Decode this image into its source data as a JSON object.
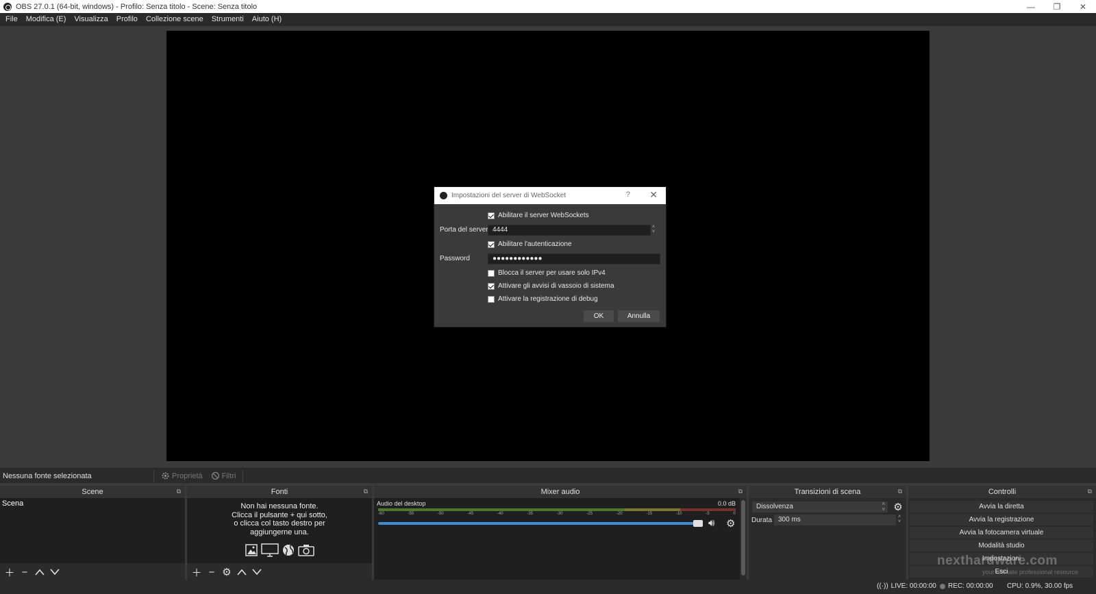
{
  "window": {
    "title": "OBS 27.0.1 (64-bit, windows) - Profilo: Senza titolo - Scene: Senza titolo",
    "minimize": "—",
    "restore": "❐",
    "close": "✕"
  },
  "menu": [
    "File",
    "Modifica (E)",
    "Visualizza",
    "Profilo",
    "Collezione scene",
    "Strumenti",
    "Aiuto (H)"
  ],
  "source_bar": {
    "selected": "Nessuna fonte selezionata",
    "properties": "Proprietà",
    "filters": "Filtri"
  },
  "docks": {
    "scenes": {
      "title": "Scene",
      "items": [
        "Scena"
      ]
    },
    "sources": {
      "title": "Fonti",
      "empty_lines": [
        "Non hai nessuna fonte.",
        "Clicca il pulsante + qui sotto,",
        "o clicca col tasto destro per",
        "aggiungerne una."
      ]
    },
    "mixer": {
      "title": "Mixer audio",
      "track": {
        "name": "Audio del desktop",
        "db": "0.0 dB"
      },
      "ticks": [
        "-60",
        "-55",
        "-50",
        "-45",
        "-40",
        "-35",
        "-30",
        "-25",
        "-20",
        "-15",
        "-10",
        "-5",
        "0"
      ],
      "volume_fraction": 1.0
    },
    "transitions": {
      "title": "Transizioni di scena",
      "selected": "Dissolvenza",
      "duration_label": "Durata",
      "duration": "300 ms"
    },
    "controls": {
      "title": "Controlli",
      "buttons": [
        "Avvia la diretta",
        "Avvia la registrazione",
        "Avvia la fotocamera virtuale",
        "Modalità studio",
        "Impostazioni",
        "Esci"
      ]
    }
  },
  "status": {
    "live": "LIVE: 00:00:00",
    "rec": "REC: 00:00:00",
    "cpu": "CPU: 0.9%, 30.00 fps"
  },
  "watermark": {
    "brand": "nexthardware.com",
    "tagline": "your ultimate professional resource"
  },
  "dialog": {
    "title": "Impostazioni del server di WebSocket",
    "help": "?",
    "close": "✕",
    "enable_server": {
      "label": "Abilitare il server WebSockets",
      "checked": true
    },
    "port_label": "Porta del server",
    "port": "4444",
    "enable_auth": {
      "label": "Abilitare l'autenticazione",
      "checked": true
    },
    "password_label": "Password",
    "password": "●●●●●●●●●●●●",
    "ipv4": {
      "label": "Blocca il server per usare solo IPv4",
      "checked": false
    },
    "tray": {
      "label": "Attivare gli avvisi di vassoio di sistema",
      "checked": true
    },
    "debug": {
      "label": "Attivare la registrazione di debug",
      "checked": false
    },
    "ok": "OK",
    "cancel": "Annulla"
  }
}
